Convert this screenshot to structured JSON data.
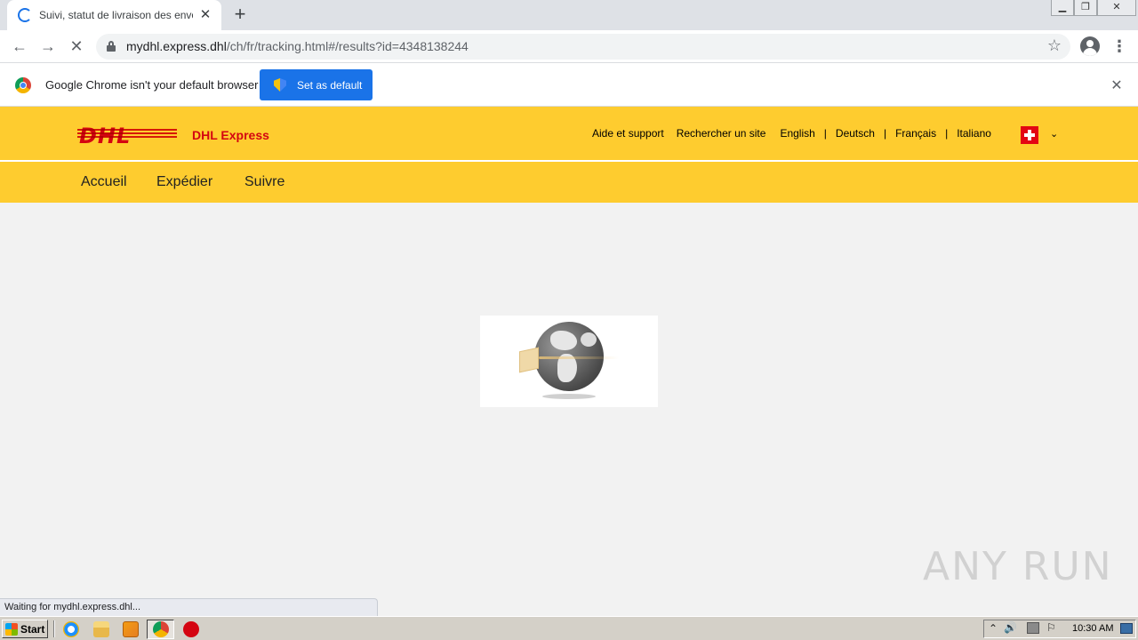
{
  "browser": {
    "tab_title": "Suivi, statut de livraison des envois D",
    "tab_close": "✕",
    "new_tab": "+",
    "url_host": "mydhl.express.dhl",
    "url_path": "/ch/fr/tracking.html#/results?id=4348138244",
    "back": "←",
    "forward": "→",
    "stop": "✕",
    "bookmark": "☆",
    "menu": "⋮",
    "window_controls": {
      "minimize": "▁",
      "restore": "❐",
      "close": "✕"
    }
  },
  "infobar": {
    "message": "Google Chrome isn't your default browser",
    "button": "Set as default",
    "close": "✕"
  },
  "dhl": {
    "logo_text": "DHL",
    "brand": "DHL Express",
    "top_links": {
      "help": "Aide et support",
      "find_site": "Rechercher un site",
      "lang_en": "English",
      "lang_de": "Deutsch",
      "lang_fr": "Français",
      "lang_it": "Italiano",
      "sep": "|"
    },
    "flag_caret": "⌄",
    "nav": {
      "home": "Accueil",
      "ship": "Expédier",
      "track": "Suivre"
    }
  },
  "status_text": "Waiting for mydhl.express.dhl...",
  "watermark": "ANY RUN",
  "taskbar": {
    "start": "Start",
    "clock": "10:30 AM",
    "tray_arrow": "⌃",
    "tray_volume": "🔊",
    "tray_flag": "⚐"
  },
  "colors": {
    "dhl_yellow": "#fecc2f",
    "dhl_red": "#d40511",
    "chrome_blue": "#1a73e8"
  }
}
